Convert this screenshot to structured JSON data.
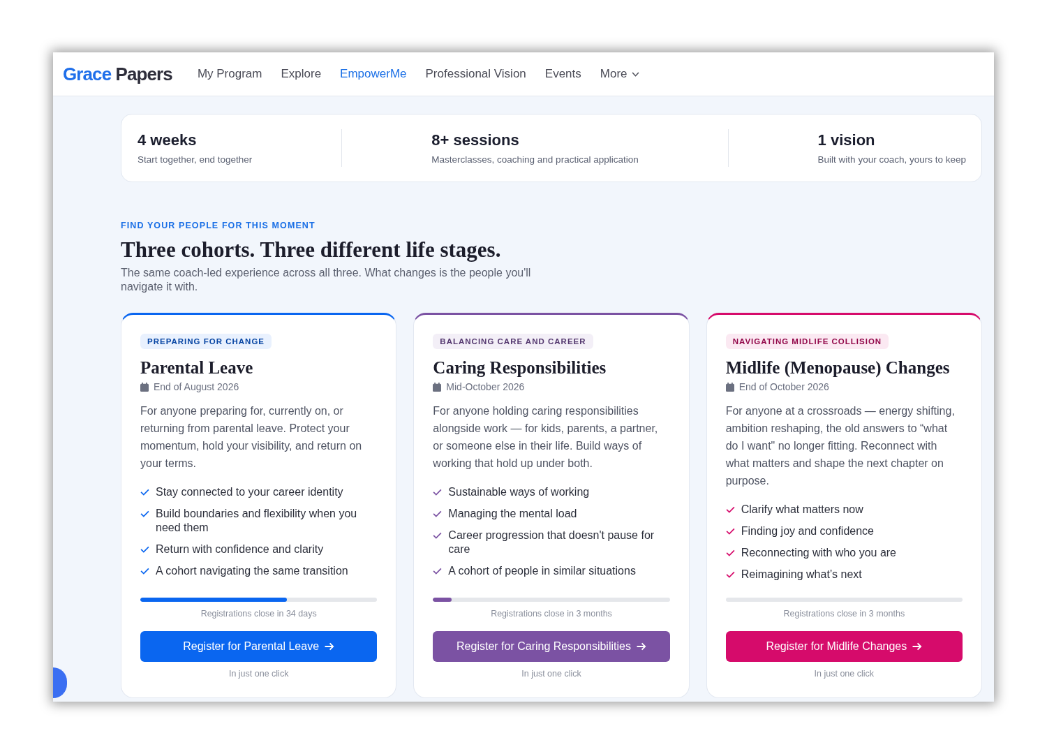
{
  "nav": {
    "logo": {
      "first": "Grace",
      "second": "Papers"
    },
    "items": [
      {
        "label": "My Program",
        "selected": false,
        "kind": "link"
      },
      {
        "label": "Explore",
        "selected": false,
        "kind": "link"
      },
      {
        "label": "EmpowerMe",
        "selected": true,
        "kind": "link"
      },
      {
        "label": "Professional Vision",
        "selected": false,
        "kind": "link"
      },
      {
        "label": "Events",
        "selected": false,
        "kind": "link"
      },
      {
        "label": "More",
        "selected": false,
        "kind": "dropdown"
      }
    ]
  },
  "stats": [
    {
      "value": "4 weeks",
      "caption": "Start together, end together"
    },
    {
      "value": "8+ sessions",
      "caption": "Masterclasses, coaching and practical application"
    },
    {
      "value": "1 vision",
      "caption": "Built with your coach, yours to keep"
    }
  ],
  "section": {
    "eyebrow": "FIND YOUR PEOPLE FOR THIS MOMENT",
    "heading": "Three cohorts. Three different life stages.",
    "subtitle": "The same coach-led experience across all three. What changes is the people you'll navigate it with."
  },
  "cohorts": [
    {
      "color": "#0a66f0",
      "badge": "PREPARING FOR CHANGE",
      "title": "Parental Leave",
      "date": "End of August 2026",
      "description": "For anyone preparing for, currently on, or returning from parental leave. Protect your momentum, hold your visibility, and return on your terms.",
      "benefits": [
        "Stay connected to your career identity",
        "Build boundaries and flexibility when you need them",
        "Return with confidence and clarity",
        "A cohort navigating the same transition"
      ],
      "level": 0.62,
      "deadline": "Registrations close in 34 days",
      "button": "Register for Parental Leave",
      "note": "In just one click"
    },
    {
      "color": "#7b52a3",
      "badge": "BALANCING CARE AND CAREER",
      "title": "Caring Responsibilities",
      "date": "Mid-October 2026",
      "description": "For anyone holding caring responsibilities alongside work — for kids, parents, a partner, or someone else in their life. Build ways of working that hold up under both.",
      "benefits": [
        "Sustainable ways of working",
        "Managing the mental load",
        "Career progression that doesn't pause for care",
        "A cohort of people in similar situations"
      ],
      "level": 0.08,
      "deadline": "Registrations close in 3 months",
      "button": "Register for Caring Responsibilities",
      "note": "In just one click"
    },
    {
      "color": "#d60b6b",
      "badge": "NAVIGATING MIDLIFE COLLISION",
      "title": "Midlife (Menopause) Changes",
      "date": "End of October 2026",
      "description": "For anyone at a crossroads — energy shifting, ambition reshaping, the old answers to “what do I want\" no longer fitting. Reconnect with what matters and shape the next chapter on purpose.",
      "benefits": [
        "Clarify what matters now",
        "Finding joy and confidence",
        "Reconnecting with who you are",
        "Reimagining what’s next"
      ],
      "deadline": "Registrations close in 3 months",
      "button": "Register for Midlife Changes",
      "note": "In just one click"
    }
  ]
}
